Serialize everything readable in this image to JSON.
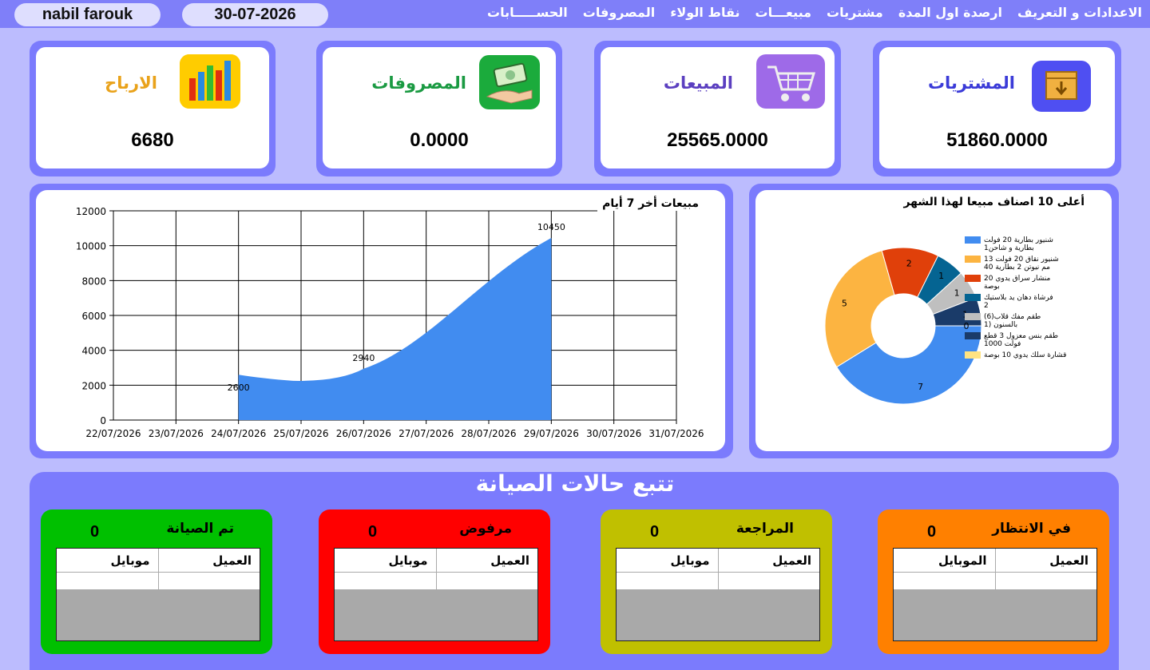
{
  "header": {
    "user": "nabil farouk",
    "date": "30-07-2026",
    "menu": [
      "الاعدادات و التعريف",
      "ارصدة اول المدة",
      "مشتريات",
      "مبيعـــات",
      "نقاط الولاء",
      "المصروفات",
      "الحســـــابات"
    ]
  },
  "cards": {
    "purchases": {
      "title": "المشتريات",
      "value": "51860.0000",
      "icon": "box-down-icon",
      "color": "#3b3bd8"
    },
    "sales": {
      "title": "المبيعات",
      "value": "25565.0000",
      "icon": "cart-icon",
      "color": "#5b3fc0"
    },
    "expenses": {
      "title": "المصروفات",
      "value": "0.0000",
      "icon": "money-hand-icon",
      "color": "#1a9a42"
    },
    "profits": {
      "title": "الارباح",
      "value": "6680",
      "icon": "bar-chart-icon",
      "color": "#e9a21a"
    }
  },
  "sales_chart": {
    "title": "مبيعات أخر 7 أيام"
  },
  "top_items_chart": {
    "title": "أعلى 10 اصناف مبيعا لهذا الشهر"
  },
  "chart_data": [
    {
      "type": "area",
      "title": "مبيعات أخر 7 أيام",
      "xlabel": "",
      "ylabel": "",
      "x": [
        "22/07/2026",
        "23/07/2026",
        "24/07/2026",
        "25/07/2026",
        "26/07/2026",
        "27/07/2026",
        "28/07/2026",
        "29/07/2026",
        "30/07/2026",
        "31/07/2026"
      ],
      "ylim": [
        0,
        12000
      ],
      "yticks": [
        0,
        2000,
        4000,
        6000,
        8000,
        10000,
        12000
      ],
      "series": [
        {
          "x": [
            "24/07/2026",
            "26/07/2026",
            "29/07/2026"
          ],
          "values": [
            2600,
            2940,
            10450
          ],
          "color": "#418cf0"
        }
      ],
      "grid": true
    },
    {
      "type": "pie",
      "title": "أعلى 10 اصناف مبيعا لهذا الشهر",
      "donut": true,
      "legend": "right",
      "slices": [
        {
          "label": "شنيور بطارية 20 فولت 1بطارية و شاحن",
          "value": 7,
          "color": "#418cf0"
        },
        {
          "label": "شنيور نقاق 20 فولت 13 مم نيوتن 2 بطارية 40",
          "value": 5,
          "color": "#fcb441"
        },
        {
          "label": "منشار سراق يدوي 20 بوصة",
          "value": 2,
          "color": "#e0400a"
        },
        {
          "label": "فرشاة دهان يد بلاستيك 2",
          "value": 1,
          "color": "#056492"
        },
        {
          "label": "(6)طقم مفك قلاب بالسنون (1",
          "value": 1,
          "color": "#bfbfbf"
        },
        {
          "label": "طقم بنس معزول 3 قطع 1000 فولت",
          "value": 1,
          "color": "#1a3b69"
        },
        {
          "label": "قشارة سلك يدوي 10 بوصة",
          "value": 0,
          "color": "#ffe382"
        }
      ]
    }
  ],
  "maintenance": {
    "title": "تتبع حالات الصيانة",
    "statuses": [
      {
        "label": "في الانتظار",
        "count": "0",
        "col1": "العميل",
        "col2": "الموبايل",
        "color": "#ff8000"
      },
      {
        "label": "المراجعة",
        "count": "0",
        "col1": "العميل",
        "col2": "موبايل",
        "color": "#c0c000"
      },
      {
        "label": "مرفوض",
        "count": "0",
        "col1": "العميل",
        "col2": "موبايل",
        "color": "#ff0000"
      },
      {
        "label": "تم الصيانة",
        "count": "0",
        "col1": "العميل",
        "col2": "موبايل",
        "color": "#00c000"
      }
    ]
  }
}
